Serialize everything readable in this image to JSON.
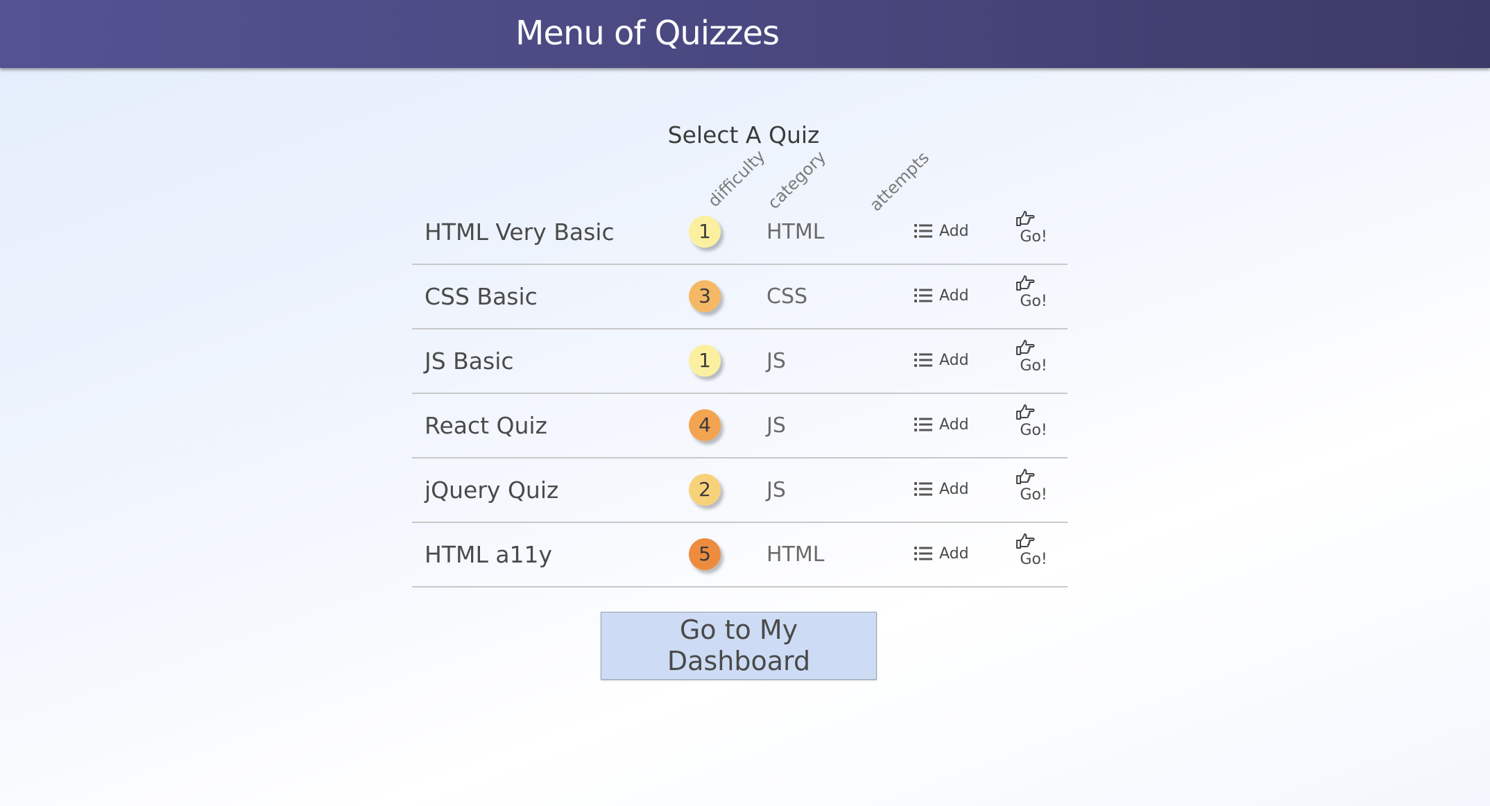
{
  "header": {
    "title": "Menu of Quizzes"
  },
  "main": {
    "heading": "Select A Quiz",
    "columns": {
      "difficulty": "difficulty",
      "category": "category",
      "attempts": "attempts"
    },
    "quizzes": [
      {
        "name": "HTML Very Basic",
        "difficulty": "1",
        "difficulty_color": "#fbf0a0",
        "category": "HTML",
        "add_label": "Add",
        "go_label": "Go!"
      },
      {
        "name": "CSS Basic",
        "difficulty": "3",
        "difficulty_color": "#f5b865",
        "category": "CSS",
        "add_label": "Add",
        "go_label": "Go!"
      },
      {
        "name": "JS Basic",
        "difficulty": "1",
        "difficulty_color": "#fbf0a0",
        "category": "JS",
        "add_label": "Add",
        "go_label": "Go!"
      },
      {
        "name": "React Quiz",
        "difficulty": "4",
        "difficulty_color": "#f3a451",
        "category": "JS",
        "add_label": "Add",
        "go_label": "Go!"
      },
      {
        "name": "jQuery Quiz",
        "difficulty": "2",
        "difficulty_color": "#f8d27a",
        "category": "JS",
        "add_label": "Add",
        "go_label": "Go!"
      },
      {
        "name": "HTML a11y",
        "difficulty": "5",
        "difficulty_color": "#ed8c3f",
        "category": "HTML",
        "add_label": "Add",
        "go_label": "Go!"
      }
    ],
    "dashboard_button": "Go to My Dashboard"
  },
  "colors": {
    "header_bg": "#4a4880",
    "button_bg": "#cddcf4"
  }
}
